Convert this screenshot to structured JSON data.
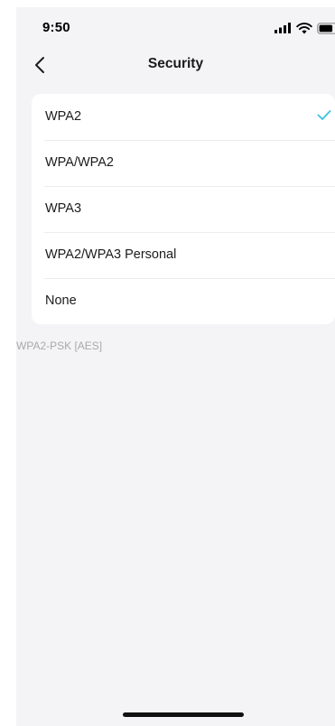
{
  "status_bar": {
    "time": "9:50",
    "icons": [
      "signal-icon",
      "wifi-icon",
      "battery-icon"
    ]
  },
  "nav": {
    "back_icon": "chevron-left-icon",
    "title": "Security"
  },
  "options": [
    {
      "label": "WPA2",
      "selected": true
    },
    {
      "label": "WPA/WPA2",
      "selected": false
    },
    {
      "label": "WPA3",
      "selected": false
    },
    {
      "label": "WPA2/WPA3 Personal",
      "selected": false
    },
    {
      "label": "None",
      "selected": false
    }
  ],
  "hint": "WPA2-PSK [AES]",
  "colors": {
    "accent_check": "#3cc3e0",
    "background": "#f4f4f6",
    "card": "#ffffff"
  }
}
